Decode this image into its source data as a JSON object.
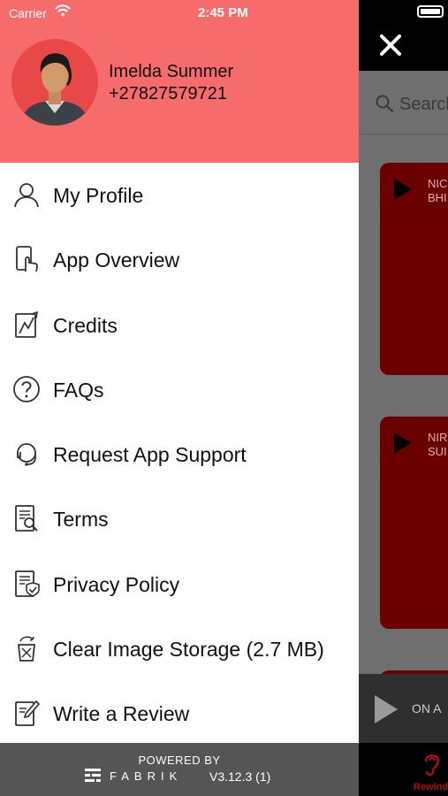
{
  "status_bar": {
    "carrier": "Carrier",
    "time": "2:45 PM"
  },
  "user": {
    "name": "Imelda Summer",
    "phone": "+27827579721"
  },
  "menu": [
    {
      "label": "My Profile",
      "icon": "user-icon"
    },
    {
      "label": "App Overview",
      "icon": "tap-phone-icon"
    },
    {
      "label": "Credits",
      "icon": "credits-icon"
    },
    {
      "label": "FAQs",
      "icon": "question-icon"
    },
    {
      "label": "Request App Support",
      "icon": "headset-icon"
    },
    {
      "label": "Terms",
      "icon": "document-search-icon"
    },
    {
      "label": "Privacy Policy",
      "icon": "shield-document-icon"
    },
    {
      "label": "Clear Image Storage (2.7 MB)",
      "icon": "trash-clear-icon"
    },
    {
      "label": "Write a Review",
      "icon": "pencil-document-icon"
    }
  ],
  "footer": {
    "powered_by": "POWERED BY",
    "brand": "FABRIK",
    "version": "V3.12.3 (1)"
  },
  "background": {
    "search_placeholder": "Search",
    "cards": [
      {
        "line1": "NIC",
        "line2": "BHI"
      },
      {
        "line1": "NIR",
        "line2": "SUI"
      }
    ],
    "mini_player_label": "ON A",
    "tab_label": "Rewind"
  },
  "colors": {
    "header": "#f66c6c",
    "footer": "#555555",
    "card": "#6a0000"
  }
}
